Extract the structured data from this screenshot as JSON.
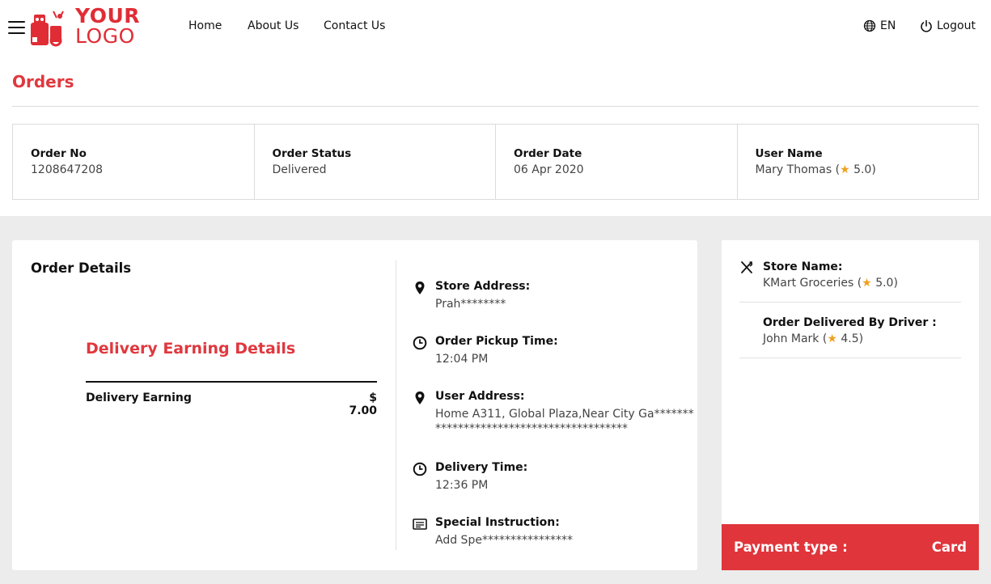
{
  "header": {
    "logo_line1": "YOUR",
    "logo_line2": "LOGO",
    "nav": [
      "Home",
      "About Us",
      "Contact Us"
    ],
    "language": "EN",
    "logout": "Logout"
  },
  "page": {
    "title": "Orders"
  },
  "summary": {
    "order_no_label": "Order No",
    "order_no": "1208647208",
    "status_label": "Order Status",
    "status": "Delivered",
    "date_label": "Order Date",
    "date": "06 Apr 2020",
    "user_label": "User Name",
    "user_name": "Mary Thomas (",
    "user_rating": "5.0)"
  },
  "details": {
    "title": "Order Details",
    "earning_title": "Delivery Earning Details",
    "earning_label": "Delivery Earning",
    "earning_value": "$ 7.00",
    "store_address_label": "Store Address:",
    "store_address": "Prah********",
    "pickup_label": "Order Pickup Time:",
    "pickup_time": "12:04 PM",
    "user_address_label": "User Address:",
    "user_address": "Home A311, Global Plaza,Near City Ga*****************************************",
    "delivery_label": "Delivery Time:",
    "delivery_time": "12:36 PM",
    "instruction_label": "Special Instruction:",
    "instruction": "Add Spe****************"
  },
  "side": {
    "store_label": "Store Name:",
    "store_name": "KMart Groceries (",
    "store_rating": "5.0)",
    "driver_label": "Order Delivered By Driver :",
    "driver_name": "John Mark (",
    "driver_rating": "4.5)",
    "payment_label": "Payment type :",
    "payment_value": "Card"
  },
  "colors": {
    "brand": "#e02d35",
    "star": "#f0a020"
  }
}
